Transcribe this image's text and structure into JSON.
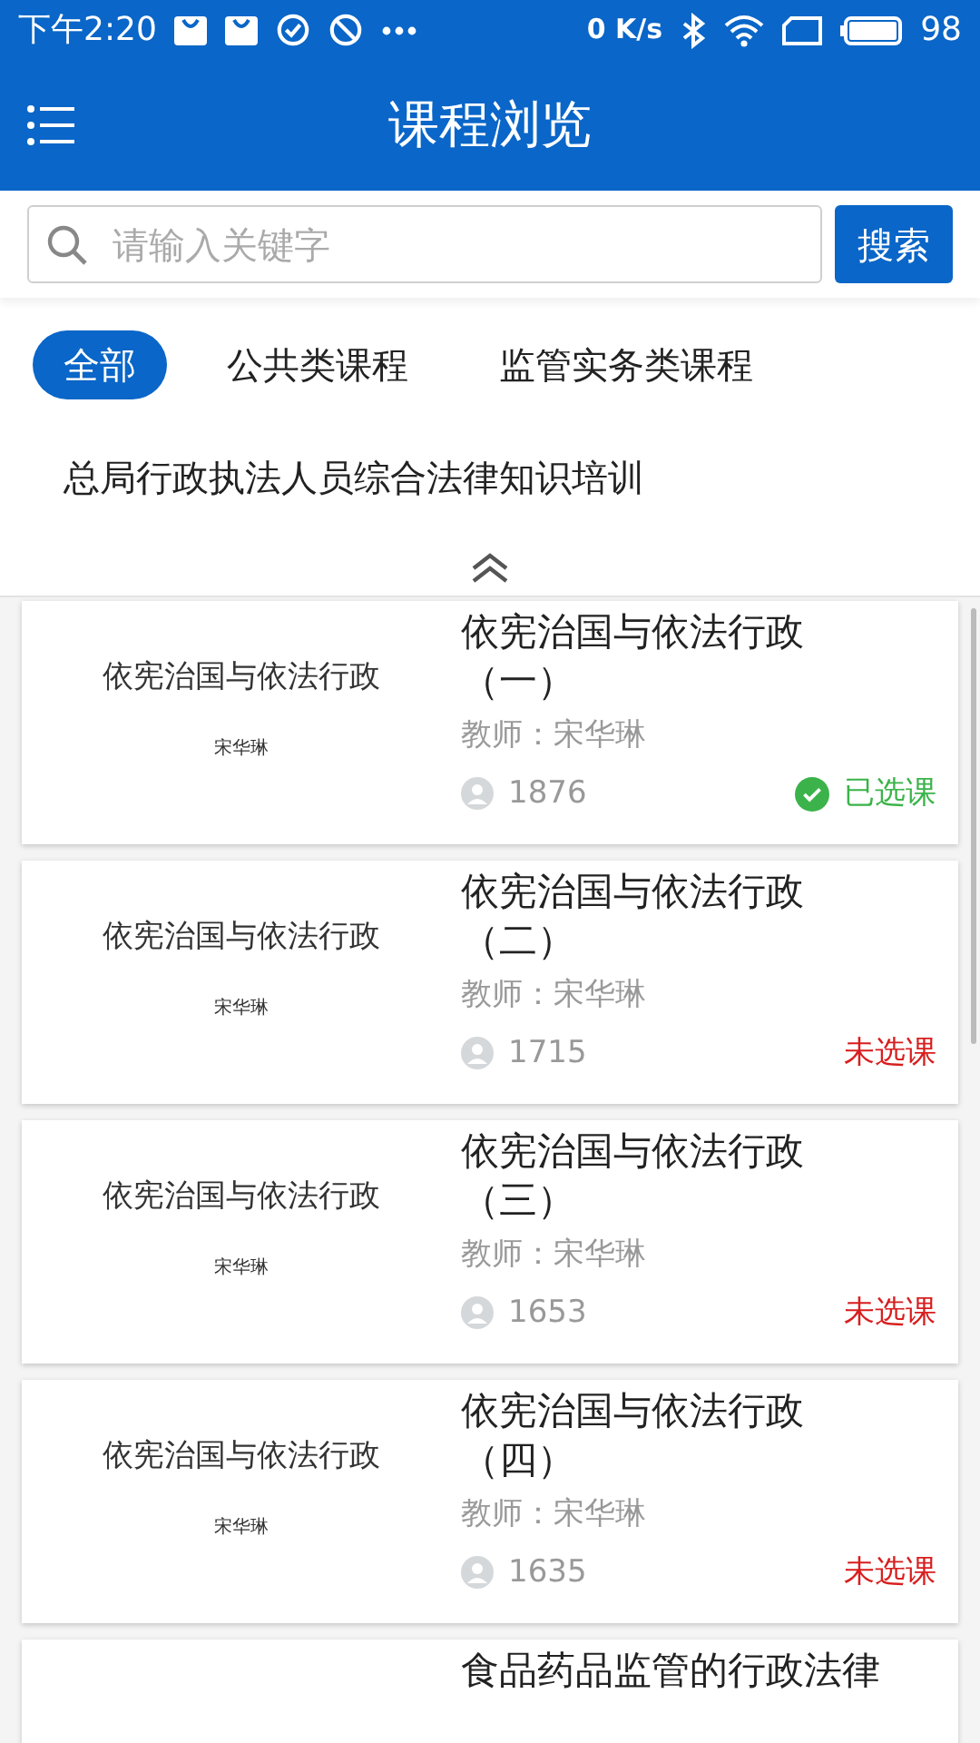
{
  "status_bar": {
    "time": "下午2:20",
    "speed": "0 K/s",
    "battery": "98"
  },
  "app_bar": {
    "title": "课程浏览"
  },
  "search": {
    "placeholder": "请输入关键字",
    "button": "搜索"
  },
  "categories": [
    {
      "label": "全部",
      "selected": true
    },
    {
      "label": "公共类课程",
      "selected": false
    },
    {
      "label": "监管实务类课程",
      "selected": false
    },
    {
      "label": "总局行政执法人员综合法律知识培训",
      "selected": false
    }
  ],
  "courses": [
    {
      "cover_title": "依宪治国与依法行政",
      "cover_author": "宋华琳",
      "title": "依宪治国与依法行政（一）",
      "teacher": "教师：宋华琳",
      "count": "1876",
      "status": "已选课",
      "selected": true
    },
    {
      "cover_title": "依宪治国与依法行政",
      "cover_author": "宋华琳",
      "title": "依宪治国与依法行政（二）",
      "teacher": "教师：宋华琳",
      "count": "1715",
      "status": "未选课",
      "selected": false
    },
    {
      "cover_title": "依宪治国与依法行政",
      "cover_author": "宋华琳",
      "title": "依宪治国与依法行政（三）",
      "teacher": "教师：宋华琳",
      "count": "1653",
      "status": "未选课",
      "selected": false
    },
    {
      "cover_title": "依宪治国与依法行政",
      "cover_author": "宋华琳",
      "title": "依宪治国与依法行政（四）",
      "teacher": "教师：宋华琳",
      "count": "1635",
      "status": "未选课",
      "selected": false
    },
    {
      "title": "食品药品监管的行政法律"
    }
  ]
}
